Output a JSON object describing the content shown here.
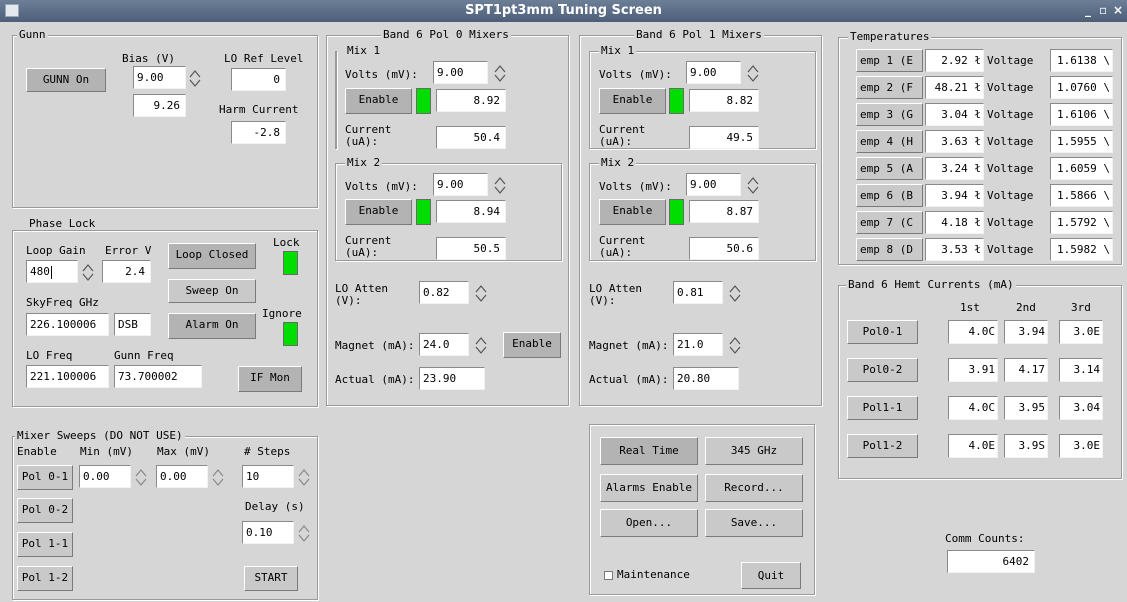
{
  "window": {
    "title": "SPT1pt3mm Tuning Screen",
    "min": "_",
    "max": "▫",
    "close": "×"
  },
  "gunn": {
    "title": "Gunn",
    "bias_label": "Bias (V)",
    "lo_ref_label": "LO Ref Level",
    "gunn_button": "GUNN On",
    "bias_set": "9.00",
    "bias_read": "9.26",
    "lo_ref_value": "0",
    "harm_label": "Harm Current",
    "harm_value": "-2.8"
  },
  "phaselock": {
    "title": "Phase Lock",
    "loop_gain_label": "Loop Gain",
    "error_label": "Error V",
    "loop_gain": "480",
    "error_v": "2.4",
    "loop_button": "Loop Closed",
    "lock_label": "Lock",
    "sweep_button": "Sweep On",
    "ignore_label": "Ignore",
    "skyfreq_label": "SkyFreq GHz",
    "skyfreq": "226.100006",
    "sideband": "DSB",
    "alarm_button": "Alarm On",
    "lofreq_label": "LO Freq",
    "gunnfreq_label": "Gunn Freq",
    "lofreq": "221.100006",
    "gunnfreq": "73.700002",
    "ifmon_button": "IF Mon"
  },
  "pol0": {
    "title": "Band 6 Pol 0 Mixers",
    "mix1": {
      "title": "Mix 1",
      "volts_label": "Volts (mV):",
      "volts_set": "9.00",
      "enable": "Enable",
      "volts_read": "8.92",
      "current_label": "Current\n(uA):",
      "current": "50.4"
    },
    "mix2": {
      "title": "Mix 2",
      "volts_label": "Volts (mV):",
      "volts_set": "9.00",
      "enable": "Enable",
      "volts_read": "8.94",
      "current_label": "Current\n(uA):",
      "current": "50.5"
    },
    "lo_atten_label": "LO Atten\n(V):",
    "lo_atten": "0.82",
    "magnet_label": "Magnet (mA):",
    "magnet": "24.0",
    "magnet_enable": "Enable",
    "actual_label": "Actual (mA):",
    "actual": "23.90"
  },
  "pol1": {
    "title": "Band 6 Pol 1 Mixers",
    "mix1": {
      "title": "Mix 1",
      "volts_label": "Volts (mV):",
      "volts_set": "9.00",
      "enable": "Enable",
      "volts_read": "8.82",
      "current_label": "Current\n(uA):",
      "current": "49.5"
    },
    "mix2": {
      "title": "Mix 2",
      "volts_label": "Volts (mV):",
      "volts_set": "9.00",
      "enable": "Enable",
      "volts_read": "8.87",
      "current_label": "Current\n(uA):",
      "current": "50.6"
    },
    "lo_atten_label": "LO Atten\n(V):",
    "lo_atten": "0.81",
    "magnet_label": "Magnet (mA):",
    "magnet": "21.0",
    "actual_label": "Actual (mA):",
    "actual": "20.80"
  },
  "temps": {
    "title": "Temperatures",
    "voltage_label": "Voltage",
    "rows": [
      {
        "name": "emp 1 (E",
        "temp": "2.92 ł",
        "volt": "1.6138 \\"
      },
      {
        "name": "emp 2 (F",
        "temp": "48.21 ł",
        "volt": "1.0760 \\"
      },
      {
        "name": "emp 3 (G",
        "temp": "3.04 ł",
        "volt": "1.6106 \\"
      },
      {
        "name": "emp 4 (H",
        "temp": "3.63 ł",
        "volt": "1.5955 \\"
      },
      {
        "name": "emp 5 (A",
        "temp": "3.24 ł",
        "volt": "1.6059 \\"
      },
      {
        "name": "emp 6 (B",
        "temp": "3.94 ł",
        "volt": "1.5866 \\"
      },
      {
        "name": "emp 7 (C",
        "temp": "4.18 ł",
        "volt": "1.5792 \\"
      },
      {
        "name": "emp 8 (D",
        "temp": "3.53 ł",
        "volt": "1.5982 \\"
      }
    ]
  },
  "hemt": {
    "title": "Band 6 Hemt Currents (mA)",
    "col1": "1st",
    "col2": "2nd",
    "col3": "3rd",
    "rows": [
      {
        "name": "Pol0-1",
        "v1": "4.0C",
        "v2": "3.94",
        "v3": "3.0E"
      },
      {
        "name": "Pol0-2",
        "v1": "3.91",
        "v2": "4.17",
        "v3": "3.14"
      },
      {
        "name": "Pol1-1",
        "v1": "4.0C",
        "v2": "3.95",
        "v3": "3.04"
      },
      {
        "name": "Pol1-2",
        "v1": "4.0E",
        "v2": "3.9S",
        "v3": "3.0E"
      }
    ]
  },
  "sweeps": {
    "title": "Mixer Sweeps (DO NOT USE)",
    "enable_label": "Enable",
    "min_label": "Min (mV)",
    "max_label": "Max (mV)",
    "steps_label": "# Steps",
    "min": "0.00",
    "max": "0.00",
    "steps": "10",
    "delay_label": "Delay (s)",
    "delay": "0.10",
    "start": "START",
    "pols": [
      "Pol 0-1",
      "Pol 0-2",
      "Pol 1-1",
      "Pol 1-2"
    ]
  },
  "controls": {
    "realtime": "Real Time",
    "freq": "345 GHz",
    "alarms": "Alarms Enable",
    "record": "Record...",
    "open": "Open...",
    "save": "Save...",
    "maintenance": "Maintenance",
    "quit": "Quit"
  },
  "comm": {
    "label": "Comm Counts:",
    "value": "6402"
  }
}
